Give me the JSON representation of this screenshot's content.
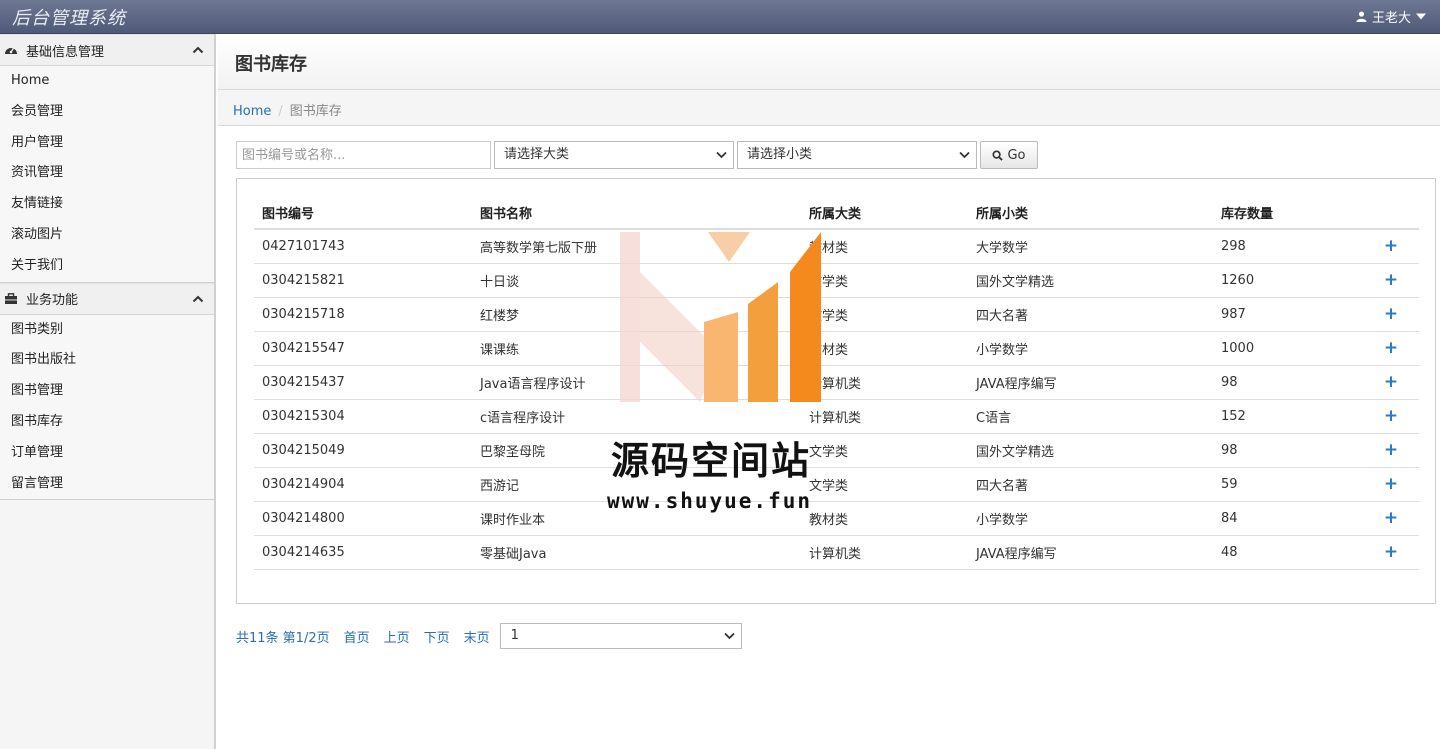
{
  "app": {
    "title": "后台管理系统",
    "user": "王老大"
  },
  "sidebar": {
    "groups": [
      {
        "label": "基础信息管理",
        "items": [
          "Home",
          "会员管理",
          "用户管理",
          "资讯管理",
          "友情链接",
          "滚动图片",
          "关于我们"
        ]
      },
      {
        "label": "业务功能",
        "items": [
          "图书类别",
          "图书出版社",
          "图书管理",
          "图书库存",
          "订单管理",
          "留言管理"
        ]
      }
    ]
  },
  "page": {
    "title": "图书库存"
  },
  "breadcrumb": {
    "home": "Home",
    "current": "图书库存"
  },
  "filters": {
    "search_placeholder": "图书编号或名称...",
    "category_select": "请选择大类",
    "subcategory_select": "请选择小类",
    "go_label": "Go"
  },
  "table": {
    "headers": [
      "图书编号",
      "图书名称",
      "所属大类",
      "所属小类",
      "库存数量"
    ],
    "rows": [
      [
        "0427101743",
        "高等数学第七版下册",
        "教材类",
        "大学数学",
        "298"
      ],
      [
        "0304215821",
        "十日谈",
        "文学类",
        "国外文学精选",
        "1260"
      ],
      [
        "0304215718",
        "红楼梦",
        "文学类",
        "四大名著",
        "987"
      ],
      [
        "0304215547",
        "课课练",
        "教材类",
        "小学数学",
        "1000"
      ],
      [
        "0304215437",
        "Java语言程序设计",
        "计算机类",
        "JAVA程序编写",
        "98"
      ],
      [
        "0304215304",
        "c语言程序设计",
        "计算机类",
        "C语言",
        "152"
      ],
      [
        "0304215049",
        "巴黎圣母院",
        "文学类",
        "国外文学精选",
        "98"
      ],
      [
        "0304214904",
        "西游记",
        "文学类",
        "四大名著",
        "59"
      ],
      [
        "0304214800",
        "课时作业本",
        "教材类",
        "小学数学",
        "84"
      ],
      [
        "0304214635",
        "零基础Java",
        "计算机类",
        "JAVA程序编写",
        "48"
      ]
    ],
    "action_symbol": "+"
  },
  "pager": {
    "summary": "共11条 第1/2页",
    "first": "首页",
    "prev": "上页",
    "next": "下页",
    "last": "末页",
    "page_select": "1"
  },
  "watermark": {
    "name": "源码空间站",
    "url": "www.shuyue.fun"
  },
  "colors": {
    "topbar": "#5a6482",
    "link": "#2a6eb0",
    "action": "#2a7ac8",
    "wm_orange": "#f4891e"
  }
}
